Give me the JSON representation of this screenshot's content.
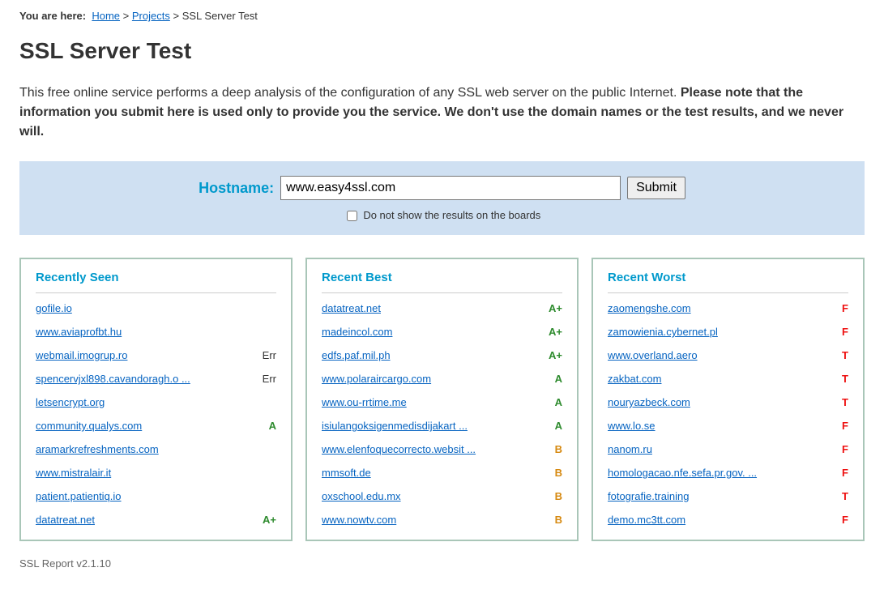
{
  "breadcrumb": {
    "label": "You are here:",
    "home": "Home",
    "projects": "Projects",
    "current": "SSL Server Test"
  },
  "page_title": "SSL Server Test",
  "intro_plain": "This free online service performs a deep analysis of the configuration of any SSL web server on the public Internet. ",
  "intro_bold": "Please note that the information you submit here is used only to provide you the service. We don't use the domain names or the test results, and we never will.",
  "form": {
    "hostname_label": "Hostname:",
    "hostname_value": "www.easy4ssl.com",
    "submit_label": "Submit",
    "hide_results_label": "Do not show the results on the boards"
  },
  "boards": {
    "recently_seen": {
      "title": "Recently Seen",
      "items": [
        {
          "domain": "gofile.io",
          "grade": "",
          "cls": ""
        },
        {
          "domain": "www.aviaprofbt.hu",
          "grade": "",
          "cls": ""
        },
        {
          "domain": "webmail.imogrup.ro",
          "grade": "Err",
          "cls": "grade-err"
        },
        {
          "domain": "spencervjxl898.cavandoragh.o ...",
          "grade": "Err",
          "cls": "grade-err"
        },
        {
          "domain": "letsencrypt.org",
          "grade": "",
          "cls": ""
        },
        {
          "domain": "community.qualys.com",
          "grade": "A",
          "cls": "grade-green"
        },
        {
          "domain": "aramarkrefreshments.com",
          "grade": "",
          "cls": ""
        },
        {
          "domain": "www.mistralair.it",
          "grade": "",
          "cls": ""
        },
        {
          "domain": "patient.patientiq.io",
          "grade": "",
          "cls": ""
        },
        {
          "domain": "datatreat.net",
          "grade": "A+",
          "cls": "grade-green"
        }
      ]
    },
    "recent_best": {
      "title": "Recent Best",
      "items": [
        {
          "domain": "datatreat.net",
          "grade": "A+",
          "cls": "grade-green"
        },
        {
          "domain": "madeincol.com",
          "grade": "A+",
          "cls": "grade-green"
        },
        {
          "domain": "edfs.paf.mil.ph",
          "grade": "A+",
          "cls": "grade-green"
        },
        {
          "domain": "www.polaraircargo.com",
          "grade": "A",
          "cls": "grade-green"
        },
        {
          "domain": "www.ou-rrtime.me",
          "grade": "A",
          "cls": "grade-green"
        },
        {
          "domain": "isiulangoksigenmedisdijakart ...",
          "grade": "A",
          "cls": "grade-green"
        },
        {
          "domain": "www.elenfoquecorrecto.websit ...",
          "grade": "B",
          "cls": "grade-orange"
        },
        {
          "domain": "mmsoft.de",
          "grade": "B",
          "cls": "grade-orange"
        },
        {
          "domain": "oxschool.edu.mx",
          "grade": "B",
          "cls": "grade-orange"
        },
        {
          "domain": "www.nowtv.com",
          "grade": "B",
          "cls": "grade-orange"
        }
      ]
    },
    "recent_worst": {
      "title": "Recent Worst",
      "items": [
        {
          "domain": "zaomengshe.com",
          "grade": "F",
          "cls": "grade-red"
        },
        {
          "domain": "zamowienia.cybernet.pl",
          "grade": "F",
          "cls": "grade-red"
        },
        {
          "domain": "www.overland.aero",
          "grade": "T",
          "cls": "grade-red"
        },
        {
          "domain": "zakbat.com",
          "grade": "T",
          "cls": "grade-red"
        },
        {
          "domain": "nouryazbeck.com",
          "grade": "T",
          "cls": "grade-red"
        },
        {
          "domain": "www.lo.se",
          "grade": "F",
          "cls": "grade-red"
        },
        {
          "domain": "nanom.ru",
          "grade": "F",
          "cls": "grade-red"
        },
        {
          "domain": "homologacao.nfe.sefa.pr.gov. ...",
          "grade": "F",
          "cls": "grade-red"
        },
        {
          "domain": "fotografie.training",
          "grade": "T",
          "cls": "grade-red"
        },
        {
          "domain": "demo.mc3tt.com",
          "grade": "F",
          "cls": "grade-red"
        }
      ]
    }
  },
  "footer": "SSL Report v2.1.10"
}
